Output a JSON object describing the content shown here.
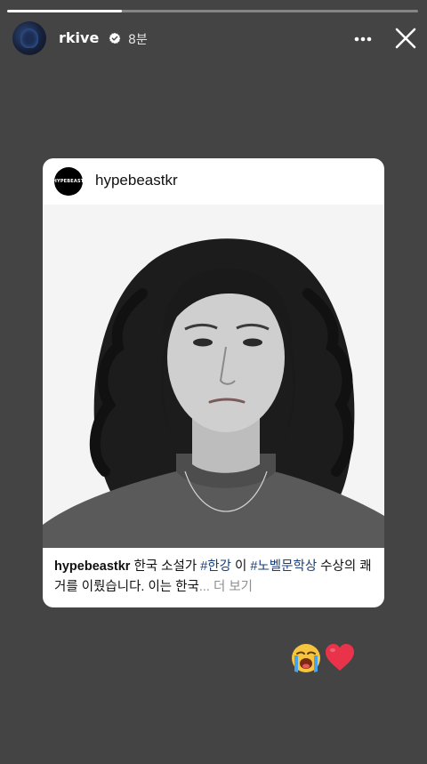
{
  "story": {
    "progress_fraction": 0.28,
    "username": "rkive",
    "time_ago": "8분",
    "icons": {
      "avatar": "user-avatar",
      "verified": "verified-badge-icon",
      "more": "more-options-icon",
      "close": "close-icon"
    }
  },
  "card": {
    "username": "hypebeastkr",
    "avatar_text": "HYPEBEAST",
    "photo": "portrait-photo",
    "caption": {
      "user": "hypebeastkr",
      "text1": " 한국 소설가 ",
      "hashtag1": "#한강",
      "text2": " 이 ",
      "hashtag2": "#노벨문학상",
      "text3": " 수상의 쾌거를 이뤘습니다. 이는 한국",
      "more": "... 더 보기"
    }
  },
  "reactions": {
    "cry": "loudly-crying-face-emoji",
    "heart": "red-heart-emoji"
  },
  "colors": {
    "background": "#444444",
    "hashtag": "#1b3f7a",
    "more_text": "#8e8e8e",
    "heart": "#e8334a"
  }
}
